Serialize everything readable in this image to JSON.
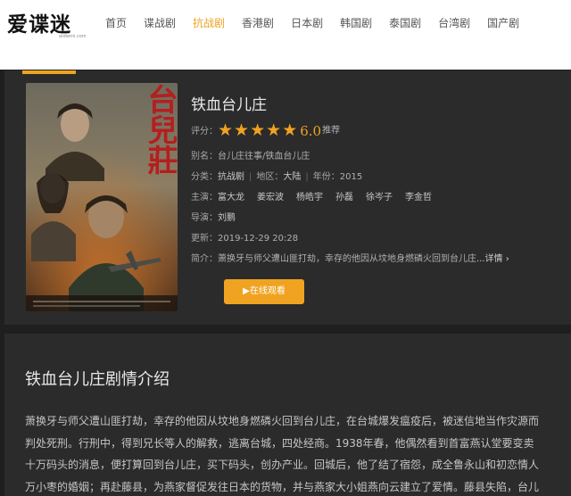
{
  "brand": {
    "logo_text": "爱谍迷",
    "logo_subtext": "aidiemi.com"
  },
  "nav": {
    "items": [
      {
        "label": "首页",
        "active": false
      },
      {
        "label": "谍战剧",
        "active": false
      },
      {
        "label": "抗战剧",
        "active": true
      },
      {
        "label": "香港剧",
        "active": false
      },
      {
        "label": "日本剧",
        "active": false
      },
      {
        "label": "韩国剧",
        "active": false
      },
      {
        "label": "泰国剧",
        "active": false
      },
      {
        "label": "台湾剧",
        "active": false
      },
      {
        "label": "国产剧",
        "active": false
      }
    ]
  },
  "poster": {
    "title_text": "台兒莊"
  },
  "detail": {
    "title": "铁血台儿庄",
    "rating_label": "评分：",
    "rating_stars": 5,
    "rating_score": "6.0",
    "rating_suffix": "推荐",
    "alias_label": "别名：",
    "alias_value": "台儿庄往事/铁血台儿庄",
    "category_label": "分类：",
    "category_value": "抗战剧",
    "region_label": "地区：",
    "region_value": "大陆",
    "year_label": "年份：",
    "year_value": "2015",
    "cast_label": "主演：",
    "cast": [
      "富大龙",
      "姜宏波",
      "杨皓宇",
      "孙磊",
      "徐岑子",
      "李金哲"
    ],
    "director_label": "导演：",
    "director_value": "刘鹏",
    "updated_label": "更新：",
    "updated_value": "2019-12-29 20:28",
    "summary_label": "简介：",
    "summary_value": "萧换牙与师父遭山匪打劫，幸存的他因从坟地身燃磷火回到台儿庄",
    "summary_more": "...详情 ›",
    "play_button": "▶在线观看"
  },
  "intro": {
    "title": "铁血台儿庄剧情介绍",
    "lines": [
      "萧换牙与师父遭山匪打劫，幸存的他因从坟地身燃磷火回到台儿庄，在台城爆发瘟疫后，被迷信地当作灾源而",
      "判处死刑。行刑中，得到兄长等人的解救，逃离台城，四处经商。1938年春，他偶然看到首富燕认堂要变卖",
      "十万码头的消息，便打算回到台儿庄，买下码头，创办产业。回城后，他了结了宿怨，成全鲁永山和初恋情人",
      "万小枣的婚姻；再赴藤县，为燕家督促发往日本的货物，并与燕家大小姐燕向云建立了爱情。藤县失陷，台儿"
    ]
  },
  "colors": {
    "accent": "#f0a321",
    "panel_bg": "#2b2b2b",
    "page_bg": "#1f1f1f"
  }
}
